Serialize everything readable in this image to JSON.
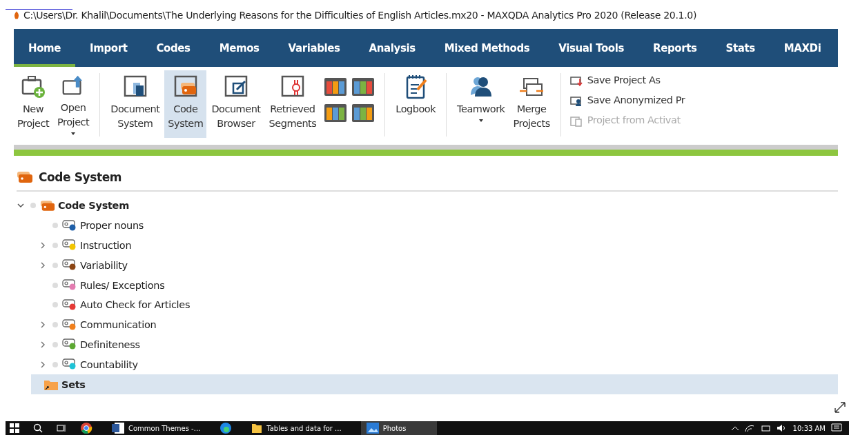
{
  "window": {
    "title": "C:\\Users\\Dr. Khalil\\Documents\\The Underlying Reasons for the Difficulties of English Articles.mx20 - MAXQDA Analytics Pro 2020 (Release 20.1.0)"
  },
  "tabs": [
    {
      "label": "Home",
      "selected": true
    },
    {
      "label": "Import",
      "selected": false
    },
    {
      "label": "Codes",
      "selected": false
    },
    {
      "label": "Memos",
      "selected": false
    },
    {
      "label": "Variables",
      "selected": false
    },
    {
      "label": "Analysis",
      "selected": false
    },
    {
      "label": "Mixed Methods",
      "selected": false
    },
    {
      "label": "Visual Tools",
      "selected": false
    },
    {
      "label": "Reports",
      "selected": false
    },
    {
      "label": "Stats",
      "selected": false
    },
    {
      "label": "MAXDi",
      "selected": false
    }
  ],
  "toolbar": [
    {
      "kind": "large",
      "label": "New Project",
      "dropdown": false,
      "selected": false
    },
    {
      "kind": "large",
      "label": "Open Project",
      "dropdown": true,
      "selected": false
    },
    {
      "kind": "separator"
    },
    {
      "kind": "large",
      "label": "Document System",
      "dropdown": false,
      "selected": false
    },
    {
      "kind": "large",
      "label": "Code System",
      "dropdown": false,
      "selected": true
    },
    {
      "kind": "large",
      "label": "Document Browser",
      "dropdown": false,
      "selected": false
    },
    {
      "kind": "large",
      "label": "Retrieved Segments",
      "dropdown": false,
      "selected": false
    },
    {
      "kind": "grid"
    },
    {
      "kind": "separator"
    },
    {
      "kind": "large",
      "label": "Logbook",
      "dropdown": false,
      "selected": false
    },
    {
      "kind": "separator"
    },
    {
      "kind": "large",
      "label": "Teamwork",
      "dropdown": true,
      "selected": false
    },
    {
      "kind": "large",
      "label": "Merge Projects",
      "dropdown": false,
      "selected": false
    },
    {
      "kind": "separator"
    },
    {
      "kind": "small",
      "items": [
        {
          "label": "Save Project As",
          "disabled": false
        },
        {
          "label": "Save Anonymized Pr",
          "disabled": false
        },
        {
          "label": "Project from Activat",
          "disabled": true
        }
      ]
    }
  ],
  "panel": {
    "title": "Code System"
  },
  "tree": [
    {
      "label": "Code System",
      "kind": "root",
      "expanded": true,
      "selected": false,
      "children": [
        {
          "label": "Proper nouns",
          "expandable": false,
          "color": "#1f5fa8"
        },
        {
          "label": "Instruction",
          "expandable": true,
          "color": "#f2c500"
        },
        {
          "label": "Variability",
          "expandable": true,
          "color": "#8b4513"
        },
        {
          "label": "Rules/ Exceptions",
          "expandable": false,
          "color": "#e37cb0"
        },
        {
          "label": "Auto Check for Articles",
          "expandable": false,
          "color": "#e53935"
        },
        {
          "label": "Communication",
          "expandable": true,
          "color": "#f07f1c"
        },
        {
          "label": "Definiteness",
          "expandable": true,
          "color": "#5ca832"
        },
        {
          "label": "Countability",
          "expandable": true,
          "color": "#1fc3d6"
        }
      ]
    },
    {
      "label": "Sets",
      "kind": "sets",
      "selected": true
    }
  ],
  "taskbar": {
    "apps": [
      {
        "label": "Common Themes -...",
        "selected": false
      },
      {
        "label": "Tables and data for ...",
        "selected": false
      },
      {
        "label": "Photos",
        "selected": true
      }
    ],
    "time": "10:33 AM"
  }
}
